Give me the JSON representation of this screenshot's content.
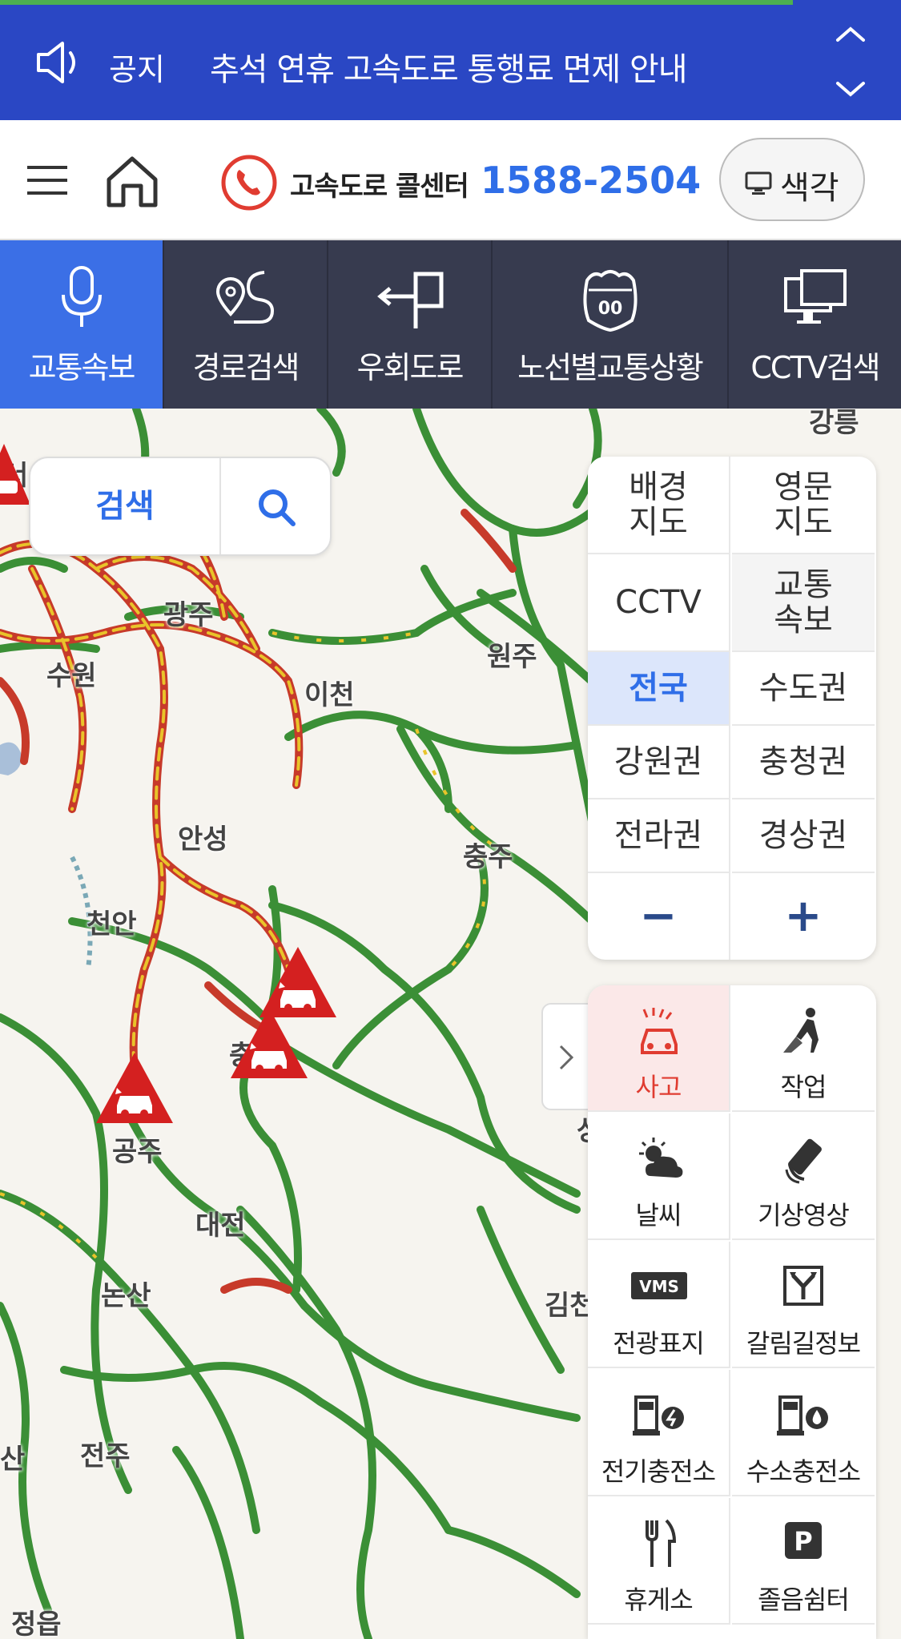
{
  "notice": {
    "label": "공지",
    "message": "추석 연휴 고속도로 통행료 면제 안내",
    "progress": 0.88
  },
  "header": {
    "callcenter_label": "고속도로 콜센터",
    "phone_number": "1588-2504",
    "color_button": "색각"
  },
  "nav": {
    "tabs": [
      {
        "label": "교통속보",
        "icon": "microphone-icon",
        "active": true
      },
      {
        "label": "경로검색",
        "icon": "route-pin-icon",
        "active": false
      },
      {
        "label": "우회도로",
        "icon": "detour-arrow-icon",
        "active": false
      },
      {
        "label": "노선별교통상황",
        "icon": "highway-shield-icon",
        "active": false
      },
      {
        "label": "CCTV검색",
        "icon": "monitor-icon",
        "active": false
      }
    ]
  },
  "search": {
    "label": "검색"
  },
  "map": {
    "places": [
      "강릉",
      "광주",
      "수원",
      "이천",
      "원주",
      "안성",
      "충주",
      "천안",
      "공주",
      "대전",
      "논산",
      "김천",
      "전주",
      "정읍",
      "산",
      "서",
      "충",
      "상"
    ]
  },
  "layers": {
    "map_types": [
      "배경\n지도",
      "영문\n지도"
    ],
    "toggles": [
      "CCTV",
      "교통\n속보"
    ],
    "regions": [
      "전국",
      "수도권",
      "강원권",
      "충청권",
      "전라권",
      "경상권"
    ],
    "selected_region": "전국",
    "zoom_out": "−",
    "zoom_in": "+"
  },
  "info": {
    "items": [
      {
        "label": "사고",
        "icon": "accident-car-icon",
        "active": true
      },
      {
        "label": "작업",
        "icon": "roadwork-icon",
        "active": false
      },
      {
        "label": "날씨",
        "icon": "weather-icon",
        "active": false
      },
      {
        "label": "기상영상",
        "icon": "satellite-icon",
        "active": false
      },
      {
        "label": "전광표지",
        "icon": "vms-icon",
        "active": false
      },
      {
        "label": "갈림길정보",
        "icon": "junction-icon",
        "active": false
      },
      {
        "label": "전기충전소",
        "icon": "ev-charger-icon",
        "active": false
      },
      {
        "label": "수소충전소",
        "icon": "hydrogen-icon",
        "active": false
      },
      {
        "label": "휴게소",
        "icon": "restaurant-icon",
        "active": false
      },
      {
        "label": "졸음쉼터",
        "icon": "parking-icon",
        "active": false
      }
    ],
    "vms_text": "VMS",
    "parking_text": "P"
  },
  "colors": {
    "notice_bg": "#2a47c4",
    "nav_bg": "#373b4f",
    "active_tab": "#3b6fe6",
    "road_green": "#3b8f36",
    "accident_red": "#d42020",
    "phone_blue": "#2f6ee8"
  }
}
